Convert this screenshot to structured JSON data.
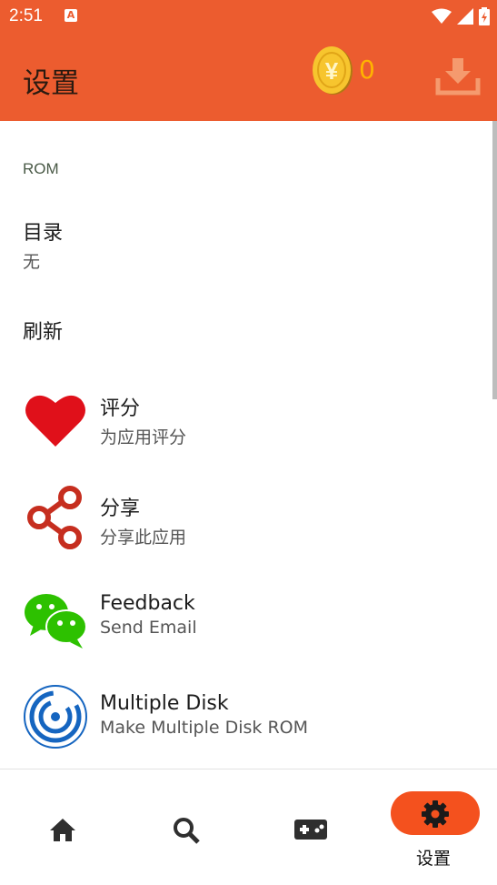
{
  "status_bar": {
    "time": "2:51",
    "notification_icon": "a-icon"
  },
  "app_bar": {
    "title": "设置",
    "coin_count": "0",
    "coin_symbol": "¥"
  },
  "colors": {
    "accent": "#ec5c2f",
    "coin": "#ffb300",
    "heart": "#e0101a",
    "share": "#c62e1f",
    "wechat": "#2dc100",
    "disk": "#1565c0"
  },
  "section": {
    "header": "ROM"
  },
  "items": [
    {
      "title": "目录",
      "subtitle": "无"
    },
    {
      "title": "刷新"
    },
    {
      "title": "评分",
      "subtitle": "为应用评分",
      "icon": "heart-icon"
    },
    {
      "title": "分享",
      "subtitle": "分享此应用",
      "icon": "share-icon"
    },
    {
      "title": "Feedback",
      "subtitle": "Send Email",
      "icon": "wechat-icon"
    },
    {
      "title": "Multiple Disk",
      "subtitle": "Make Multiple Disk ROM",
      "icon": "disk-icon"
    }
  ],
  "nav": {
    "items": [
      {
        "icon": "home-icon"
      },
      {
        "icon": "search-icon"
      },
      {
        "icon": "gamepad-icon"
      },
      {
        "icon": "gear-icon",
        "label": "设置",
        "selected": true
      }
    ]
  }
}
